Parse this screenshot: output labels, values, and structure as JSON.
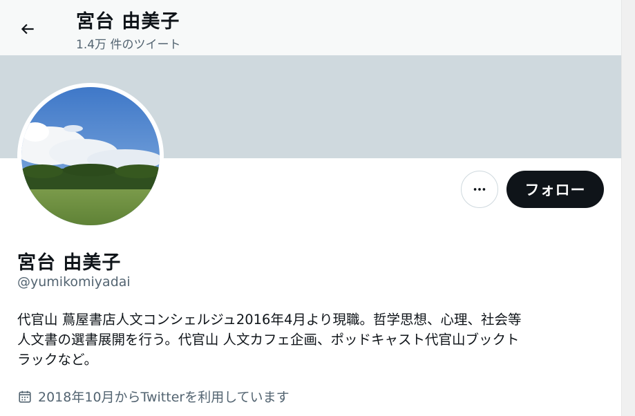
{
  "header": {
    "back_icon": "arrow-left-icon",
    "title": "宮台 由美子",
    "tweet_count": "1.4万 件のツイート"
  },
  "profile": {
    "display_name": "宮台 由美子",
    "handle": "@yumikomiyadai",
    "bio_lines": [
      "代官山 蔦屋書店人文コンシェルジュ2016年4月より現職。哲学思想、心理、社会等",
      "人文書の選書展開を行う。代官山 人文カフェ企画、ポッドキャスト代官山ブックト",
      "ラックなど。"
    ],
    "joined": "2018年10月からTwitterを利用しています",
    "joined_icon": "calendar-icon"
  },
  "actions": {
    "more_icon": "more-dots-icon",
    "follow_label": "フォロー"
  },
  "colors": {
    "banner": "#cfd9de",
    "follow_bg": "#0f1419",
    "secondary_text": "#536471"
  }
}
